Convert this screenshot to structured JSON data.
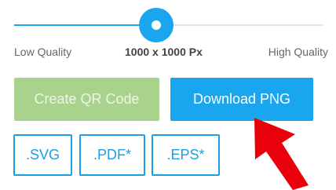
{
  "slider": {
    "value_fraction": 0.46,
    "low_label": "Low Quality",
    "size_label": "1000 x 1000 Px",
    "high_label": "High Quality"
  },
  "buttons": {
    "create_qr": "Create QR Code",
    "download_png": "Download PNG"
  },
  "formats": {
    "svg": ".SVG",
    "pdf": ".PDF*",
    "eps": ".EPS*"
  },
  "colors": {
    "accent": "#19a6ee",
    "create_button": "#a9d38c",
    "arrow": "#e8000b"
  },
  "annotation_icon": "red-arrow-icon"
}
